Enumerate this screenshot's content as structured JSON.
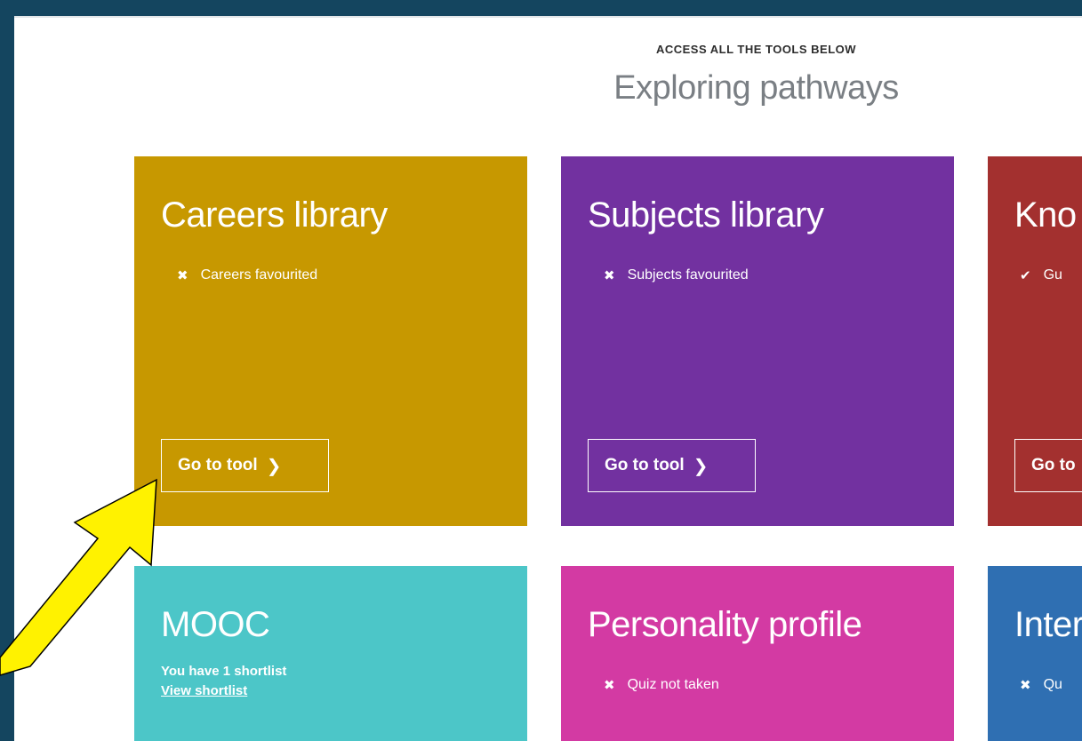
{
  "header": {
    "eyebrow": "ACCESS ALL THE TOOLS BELOW",
    "title": "Exploring pathways"
  },
  "tiles": [
    {
      "title": "Careers library",
      "status": "Careers favourited",
      "status_icon": "cross-icon",
      "status_mark": "✖",
      "button": "Go to tool",
      "color": "#c79800"
    },
    {
      "title": "Subjects library",
      "status": "Subjects favourited",
      "status_icon": "cross-icon",
      "status_mark": "✖",
      "button": "Go to tool",
      "color": "#7231a0"
    },
    {
      "title": "Kno",
      "status": "Gu",
      "status_icon": "check-icon",
      "status_mark": "✔",
      "button": "Go to",
      "color": "#a3302f"
    },
    {
      "title": "MOOC",
      "shortlist": "You have 1 shortlist",
      "link": "View shortlist",
      "color": "#4cc6c8"
    },
    {
      "title": "Personality profile",
      "status": "Quiz not taken",
      "status_icon": "cross-icon",
      "status_mark": "✖",
      "color": "#d33aa3"
    },
    {
      "title": "Inter",
      "status": "Qu",
      "status_icon": "cross-icon",
      "status_mark": "✖",
      "color": "#2f6fb2"
    }
  ],
  "chevron": "❯",
  "annotation": {
    "color": "#fff200",
    "outline": "#000000"
  }
}
